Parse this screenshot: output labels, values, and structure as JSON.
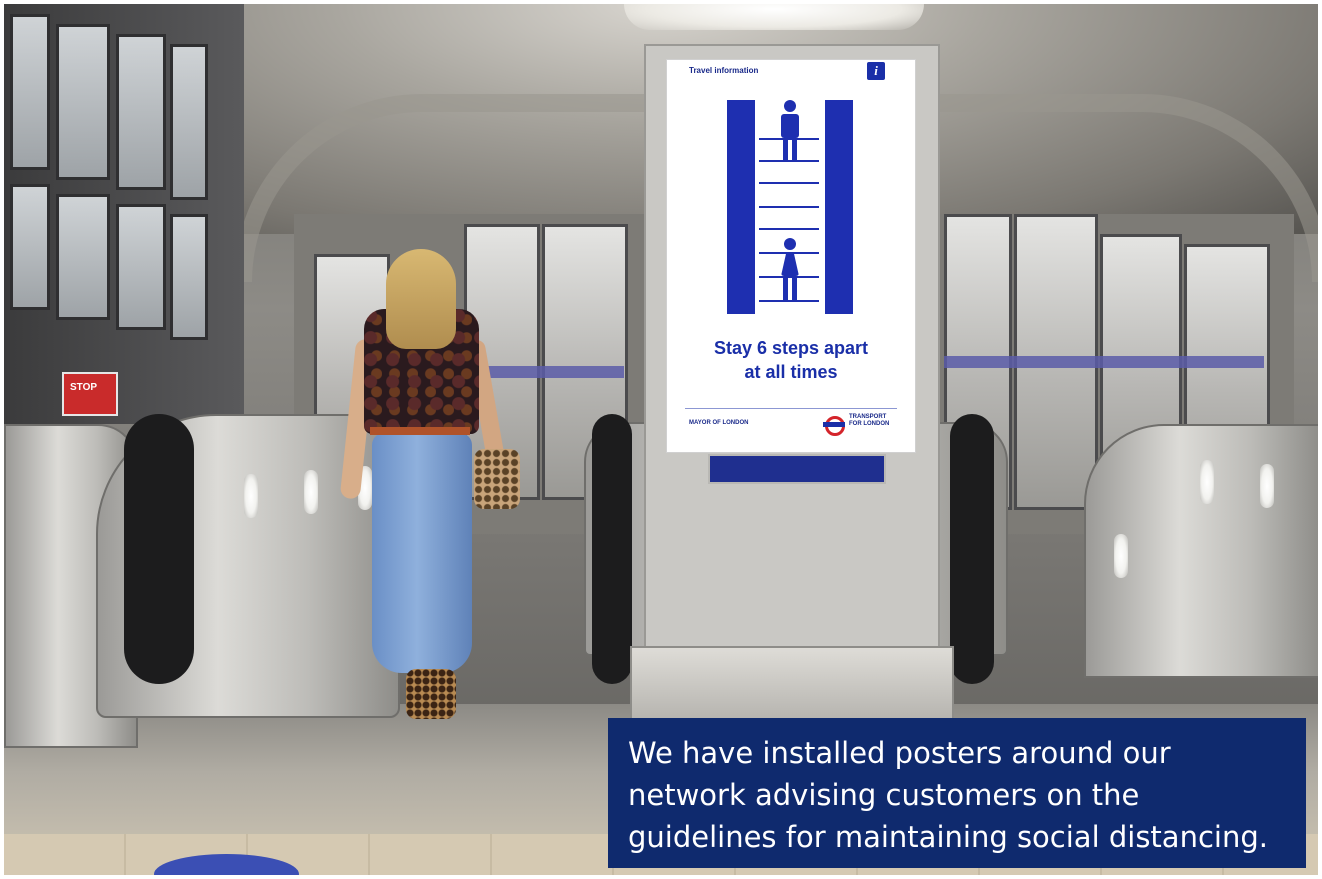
{
  "poster": {
    "header": "Travel information",
    "info_symbol": "i",
    "message_line1": "Stay 6 steps apart",
    "message_line2": "at all times",
    "footer_left": "MAYOR OF LONDON",
    "footer_right_line1": "TRANSPORT",
    "footer_right_line2": "FOR LONDON"
  },
  "stop_sign": {
    "label": "STOP"
  },
  "caption": {
    "line1": "We have installed posters around our",
    "line2": "network advising customers on the",
    "line3": "guidelines for maintaining social distancing."
  },
  "colors": {
    "caption_background": "#0f2a6e",
    "poster_blue": "#1e2fb0",
    "roundel_red": "#d4242b"
  }
}
